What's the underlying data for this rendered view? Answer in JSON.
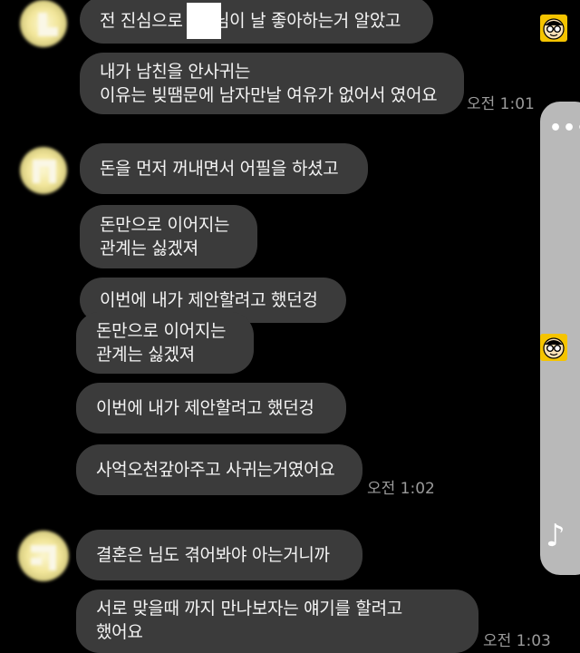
{
  "messages": [
    {
      "text": "전 진심으로 ▇▇님이 날 좋아하는거 알았고"
    },
    {
      "text": "내가 남친을 안사귀는\n이유는 빚땜문에 남자만날 여유가 없어서 였어요"
    },
    {
      "text": "돈을 먼저 꺼내면서 어필을 하셨고"
    },
    {
      "text": "돈만으로 이어지는\n관계는 싫겠져"
    },
    {
      "text": "이번에 내가 제안할려고 했던겅"
    },
    {
      "text": "돈만으로 이어지는\n관계는 싫겠져"
    },
    {
      "text": "이번에 내가 제안할려고 했던겅"
    },
    {
      "text": "사억오천갚아주고 사귀는거였어요"
    },
    {
      "text": "결혼은 님도 겪어봐야 아는거니까"
    },
    {
      "text": "서로 맞을때 까지 만나보자는 얘기를 할려고\n했어요"
    }
  ],
  "timestamps": {
    "t1": "오전 1:01",
    "t2": "오전 1:02",
    "t3": "오전 1:03"
  },
  "icons": {
    "menu": "more-dots-icon",
    "music": "music-note-icon",
    "sticker": "glasses-face-icon"
  },
  "colors": {
    "background": "#000000",
    "bubble": "#3b3b3b",
    "text": "#f4f4f4",
    "timestamp": "#9a9a9a",
    "side_panel": "#b9b9b9",
    "sticker": "#f5c400"
  }
}
